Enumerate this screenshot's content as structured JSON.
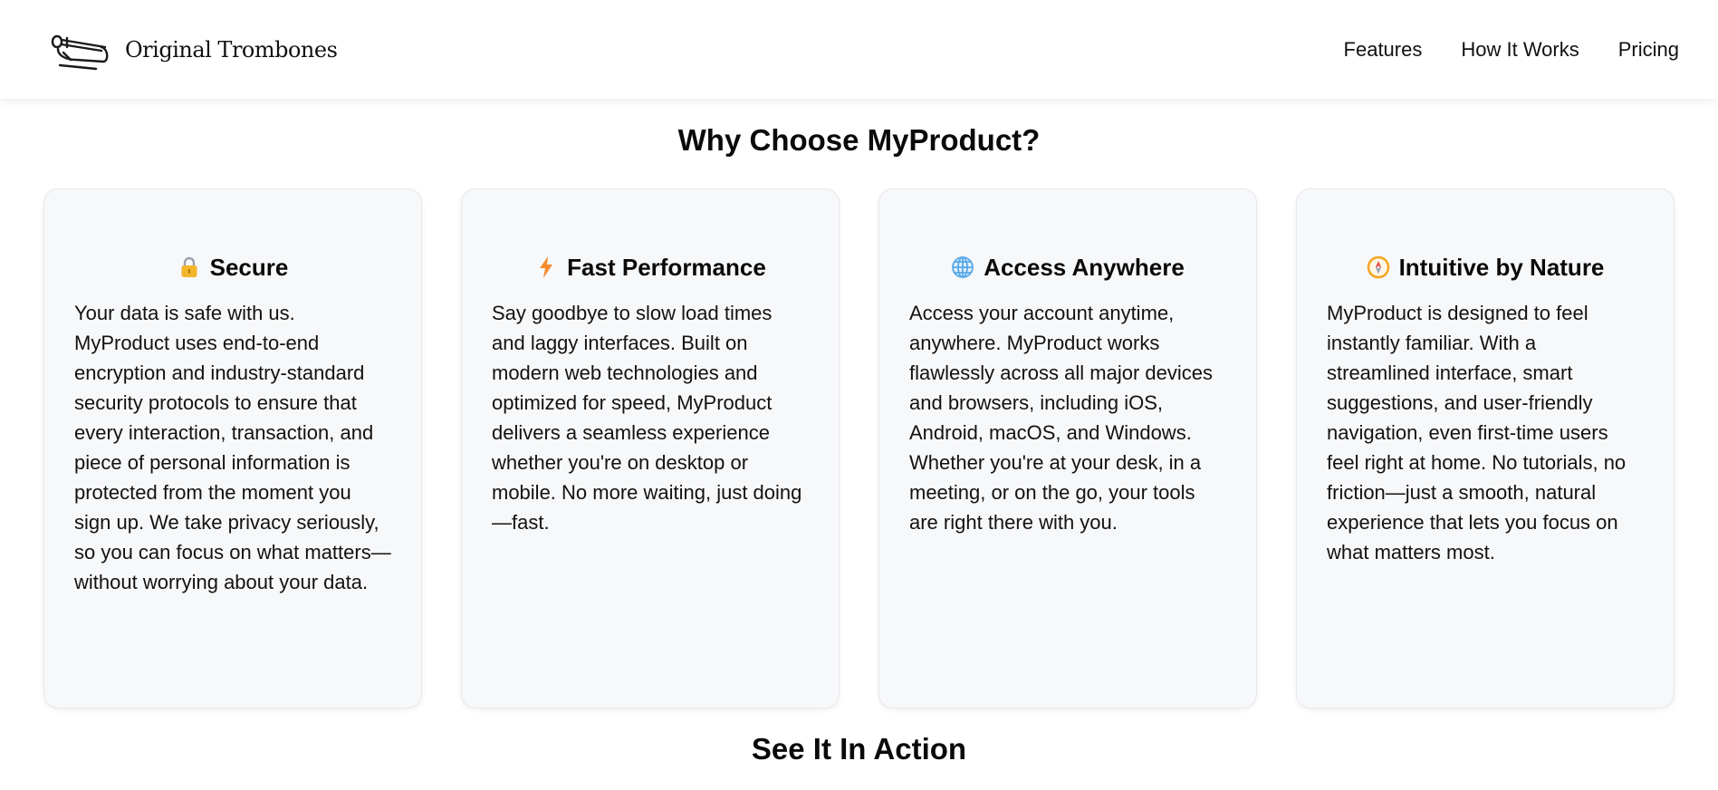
{
  "header": {
    "brand_name": "Original Trombones",
    "logo_icon": "trombone-icon",
    "nav": [
      {
        "label": "Features"
      },
      {
        "label": "How It Works"
      },
      {
        "label": "Pricing"
      }
    ]
  },
  "features": {
    "title": "Why Choose MyProduct?",
    "cards": [
      {
        "icon": "lock-icon",
        "title": "Secure",
        "body": "Your data is safe with us. MyProduct uses end-to-end encryption and industry-standard security protocols to ensure that every interaction, transaction, and piece of personal information is protected from the moment you sign up. We take privacy seriously, so you can focus on what matters—without worrying about your data."
      },
      {
        "icon": "lightning-icon",
        "title": "Fast Performance",
        "body": "Say goodbye to slow load times and laggy interfaces. Built on modern web technologies and optimized for speed, MyProduct delivers a seamless experience whether you're on desktop or mobile. No more waiting, just doing—fast."
      },
      {
        "icon": "globe-icon",
        "title": "Access Anywhere",
        "body": "Access your account anytime, anywhere. MyProduct works flawlessly across all major devices and browsers, including iOS, Android, macOS, and Windows. Whether you're at your desk, in a meeting, or on the go, your tools are right there with you."
      },
      {
        "icon": "compass-icon",
        "title": "Intuitive by Nature",
        "body": "MyProduct is designed to feel instantly familiar. With a streamlined interface, smart suggestions, and user-friendly navigation, even first-time users feel right at home. No tutorials, no friction—just a smooth, natural experience that lets you focus on what matters most."
      }
    ]
  },
  "action": {
    "title": "See It In Action"
  },
  "colors": {
    "card_bg": "#f7f8fa",
    "lock": "#f3b52a",
    "lightning": "#f58a2e",
    "globe": "#57a8e6",
    "compass": "#f4a623"
  }
}
